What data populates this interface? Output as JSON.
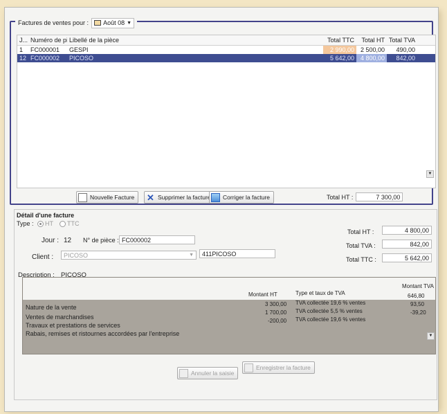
{
  "window": {
    "sales_label": "Factures de ventes pour :",
    "month_value": "Août 08"
  },
  "list": {
    "headers": [
      "J...",
      "Numéro de piè...",
      "Libellé de la pièce",
      "Total TTC",
      "Total HT",
      "Total TVA"
    ],
    "rows": [
      {
        "day": "1",
        "number": "FC000001",
        "label": "GESPI",
        "ttc": "2 990,00",
        "ht": "2 500,00",
        "tva": "490,00"
      },
      {
        "day": "12",
        "number": "FC000002",
        "label": "PICOSO",
        "ttc": "5 642,00",
        "ht": "4 800,00",
        "tva": "842,00"
      }
    ]
  },
  "toolbar": {
    "new_invoice": "Nouvelle Facture",
    "delete_invoice": "Supprimer la facture",
    "copy_invoice": "Corriger la facture",
    "total_ht_label": "Total HT :",
    "total_ht_value": "7 300,00"
  },
  "detail": {
    "title": "Détail d'une facture",
    "type_label": "Type :",
    "type_ht": "HT",
    "type_ttc": "TTC",
    "day_label": "Jour :",
    "day_value": "12",
    "piece_label": "N° de pièce :",
    "piece_value": "FC000002",
    "client_label": "Client :",
    "client_value": "PICOSO",
    "client_account": "411PICOSO",
    "description_label": "Description :",
    "description_value": "PICOSO",
    "total_ht_label": "Total HT :",
    "total_ht_value": "4 800,00",
    "total_tva_label": "Total TVA :",
    "total_tva_value": "842,00",
    "total_ttc_label": "Total TTC :",
    "total_ttc_value": "5 642,00"
  },
  "lines": {
    "header_amount": "Montant HT",
    "header_type": "Type et taux de TVA",
    "header_tva": "Montant TVA",
    "nature_label": "Nature de la vente",
    "rows": [
      {
        "nature": "Ventes de marchandises",
        "amount": "3 300,00",
        "type": "TVA collectée 19,6 % ventes",
        "tva": "646,80"
      },
      {
        "nature": "Travaux et prestations de services",
        "amount": "1 700,00",
        "type": "TVA collectée 5,5 % ventes",
        "tva": "93,50"
      },
      {
        "nature": "Rabais, remises et ristournes accordées par l'entreprise",
        "amount": "-200,00",
        "type": "TVA collectée 19,6 % ventes",
        "tva": "-39,20"
      }
    ]
  },
  "actions": {
    "cancel": "Annuler la saisie",
    "save": "Enregistrer la facture"
  },
  "colors": {
    "frame": "#43438a",
    "selection": "#3e4d91",
    "gray_table": "#a9a49c",
    "background": "#f3e6c4"
  }
}
